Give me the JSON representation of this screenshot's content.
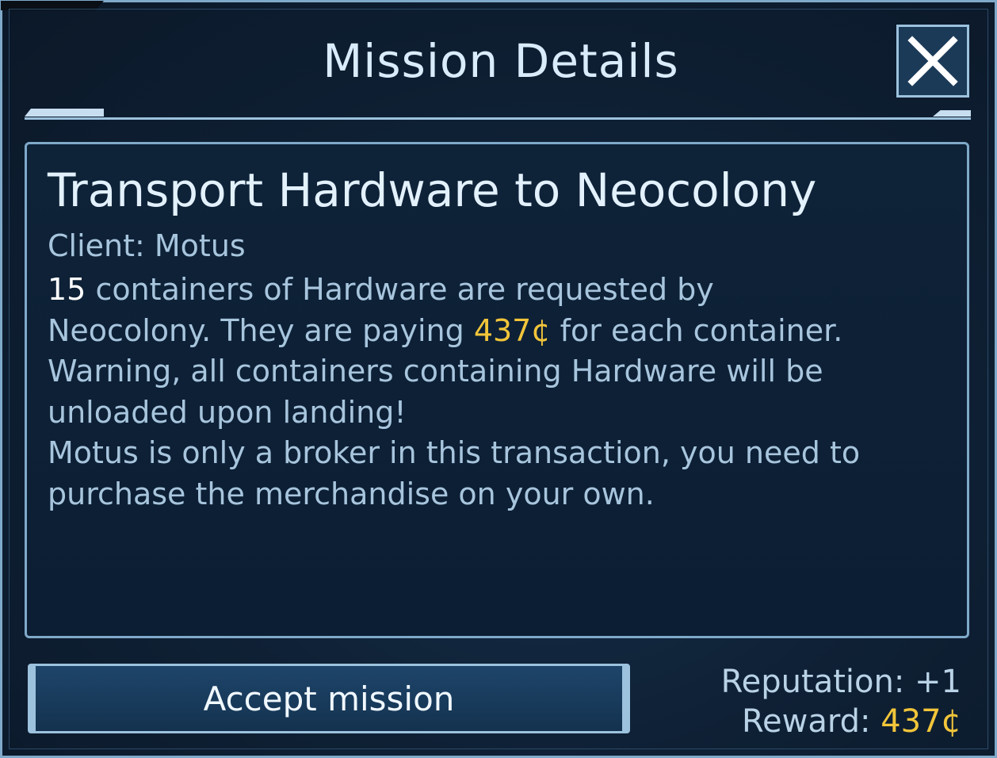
{
  "window": {
    "title": "Mission Details",
    "close_icon": "close-icon"
  },
  "mission": {
    "title": "Transport Hardware to Neocolony",
    "client_label": "Client: Motus",
    "container_count": "15",
    "line1_rest": " containers of Hardware are requested by",
    "line2_pre": "Neocolony. They are paying ",
    "price": "437¢",
    "line2_post": " for each container.",
    "warning": "Warning, all containers containing Hardware will be unloaded upon landing!",
    "broker_note": "Motus is only a broker in this transaction, you need to purchase the merchandise on your own."
  },
  "actions": {
    "accept_label": "Accept mission"
  },
  "rewards": {
    "reputation_label": "Reputation: +1",
    "reward_label": "Reward: ",
    "reward_value": "437¢"
  },
  "colors": {
    "accent": "#9cc2de",
    "gold": "#f2c53a",
    "text": "#a7c5dd",
    "background": "#0f2136"
  }
}
